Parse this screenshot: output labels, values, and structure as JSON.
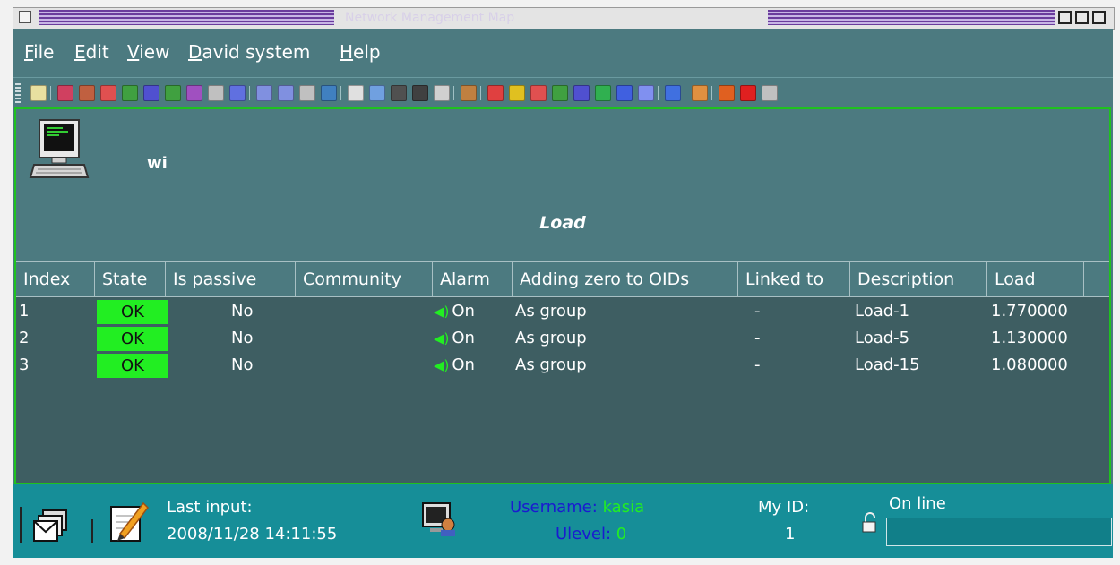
{
  "window": {
    "title": "Network Management Map"
  },
  "menu": [
    {
      "label": "File",
      "ul": "F",
      "rest": "ile"
    },
    {
      "label": "Edit",
      "ul": "E",
      "rest": "dit"
    },
    {
      "label": "View",
      "ul": "V",
      "rest": "iew"
    },
    {
      "label": "David system",
      "ul": "D",
      "rest": "avid system"
    },
    {
      "label": "Help",
      "ul": "H",
      "rest": "elp"
    }
  ],
  "toolbar": {
    "icons": [
      {
        "name": "lock-icon",
        "color": "#e8e0a0"
      },
      {
        "name": "map-add-icon",
        "color": "#d04060"
      },
      {
        "name": "edit-map-icon",
        "color": "#c06040"
      },
      {
        "name": "group-icon",
        "color": "#e05050"
      },
      {
        "name": "triangle-icon",
        "color": "#40a040"
      },
      {
        "name": "frame-icon",
        "color": "#5050d0"
      },
      {
        "name": "network-card-icon",
        "color": "#40a040"
      },
      {
        "name": "as-icon",
        "color": "#a050c0"
      },
      {
        "name": "link-icon",
        "color": "#c0c0c0"
      },
      {
        "name": "eraser-icon",
        "color": "#6070e0"
      },
      {
        "name": "zoom-map-icon",
        "color": "#8090e0"
      },
      {
        "name": "zoom-select-icon",
        "color": "#8090e0"
      },
      {
        "name": "cut-icon",
        "color": "#c0c0c0"
      },
      {
        "name": "tree-icon",
        "color": "#4080c0"
      },
      {
        "name": "home-icon",
        "color": "#e0e0e0"
      },
      {
        "name": "up-arrow-icon",
        "color": "#70a0e0"
      },
      {
        "name": "block-icon",
        "color": "#505050"
      },
      {
        "name": "block-dark-icon",
        "color": "#404040"
      },
      {
        "name": "grid-icon",
        "color": "#d0d0d0"
      },
      {
        "name": "user-icon",
        "color": "#c08040"
      },
      {
        "name": "pie-icon",
        "color": "#e04040"
      },
      {
        "name": "flower-icon",
        "color": "#e0c020"
      },
      {
        "name": "group2-icon",
        "color": "#e05050"
      },
      {
        "name": "triangle2-icon",
        "color": "#40a040"
      },
      {
        "name": "frame2-icon",
        "color": "#5050d0"
      },
      {
        "name": "layers-icon",
        "color": "#30b050"
      },
      {
        "name": "search-icon",
        "color": "#4060e0"
      },
      {
        "name": "find-icon",
        "color": "#8090f0"
      },
      {
        "name": "disc-icon",
        "color": "#4070e0"
      },
      {
        "name": "gear-icon",
        "color": "#e09040"
      },
      {
        "name": "tools-icon",
        "color": "#e06020"
      },
      {
        "name": "warning-icon",
        "color": "#e02020"
      },
      {
        "name": "document-icon",
        "color": "#c0c0c0"
      }
    ]
  },
  "device": {
    "name": "wi"
  },
  "section": {
    "title": "Load"
  },
  "table": {
    "headers": [
      "Index",
      "State",
      "Is passive",
      "Community",
      "Alarm",
      "Adding zero to OIDs",
      "Linked to",
      "Description",
      "Load"
    ],
    "rows": [
      {
        "index": "1",
        "state": "OK",
        "passive": "No",
        "community": "",
        "alarm": "On",
        "zero": "As group",
        "linked": "-",
        "description": "Load-1",
        "load": "1.770000"
      },
      {
        "index": "2",
        "state": "OK",
        "passive": "No",
        "community": "",
        "alarm": "On",
        "zero": "As group",
        "linked": "-",
        "description": "Load-5",
        "load": "1.130000"
      },
      {
        "index": "3",
        "state": "OK",
        "passive": "No",
        "community": "",
        "alarm": "On",
        "zero": "As group",
        "linked": "-",
        "description": "Load-15",
        "load": "1.080000"
      }
    ]
  },
  "status": {
    "last_input_label": "Last input:",
    "last_input_value": "2008/11/28 14:11:55",
    "username_label": "Username:",
    "username_value": "kasia",
    "ulevel_label": "Ulevel:",
    "ulevel_value": "0",
    "myid_label": "My ID:",
    "myid_value": "1",
    "online_label": "On line"
  },
  "colors": {
    "panel": "#4c7a80",
    "table_bg": "#3e5e62",
    "ok_green": "#22ee22",
    "status_teal": "#168e98",
    "username_blue": "#1a1ad0"
  }
}
